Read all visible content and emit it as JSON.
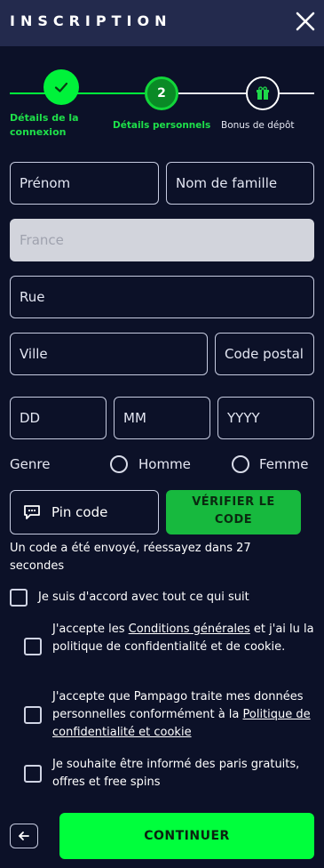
{
  "header": {
    "title": "INSCRIPTION",
    "close_icon": "close-icon"
  },
  "stepper": {
    "steps": [
      {
        "label_line1": "Détails de la",
        "label_line2": "connexion",
        "state": "done",
        "icon": "check-icon"
      },
      {
        "label": "Détails personnels",
        "number": "2",
        "state": "active"
      },
      {
        "label": "Bonus de dépôt",
        "icon": "gift-icon",
        "state": "pending"
      }
    ]
  },
  "form": {
    "first_name_placeholder": "Prénom",
    "last_name_placeholder": "Nom de famille",
    "country_placeholder": "France",
    "street_placeholder": "Rue",
    "city_placeholder": "Ville",
    "postcode_placeholder": "Code postal",
    "dd_placeholder": "DD",
    "mm_placeholder": "MM",
    "yyyy_placeholder": "YYYY",
    "genre_label": "Genre",
    "genre_options": [
      "Homme",
      "Femme"
    ]
  },
  "pin": {
    "label": "Pin code",
    "icon": "chat-icon",
    "verify_line1": "VÉRIFIER LE",
    "verify_line2": "CODE",
    "message": "Un code a été envoyé, réessayez dans 27 secondes"
  },
  "consent": {
    "all": "Je suis d'accord avec tout ce qui suit",
    "terms_pre": "J'accepte les ",
    "terms_link": "Conditions générales",
    "terms_post": " et j'ai lu la politique de confidentialité et de cookie.",
    "data_pre": "J'accepte que Pampago traite mes données personnelles conformément à la ",
    "data_link": "Politique de confidentialité et cookie",
    "newsletter": "Je souhaite être informé des paris gratuits, offres et free spins"
  },
  "footer": {
    "back_icon": "back-arrow-icon",
    "continue_label": "CONTINUER"
  },
  "colors": {
    "background": "#0c1128",
    "header": "#232a4d",
    "accent_green": "#00ff3c",
    "step_green": "#0fbf2a"
  }
}
